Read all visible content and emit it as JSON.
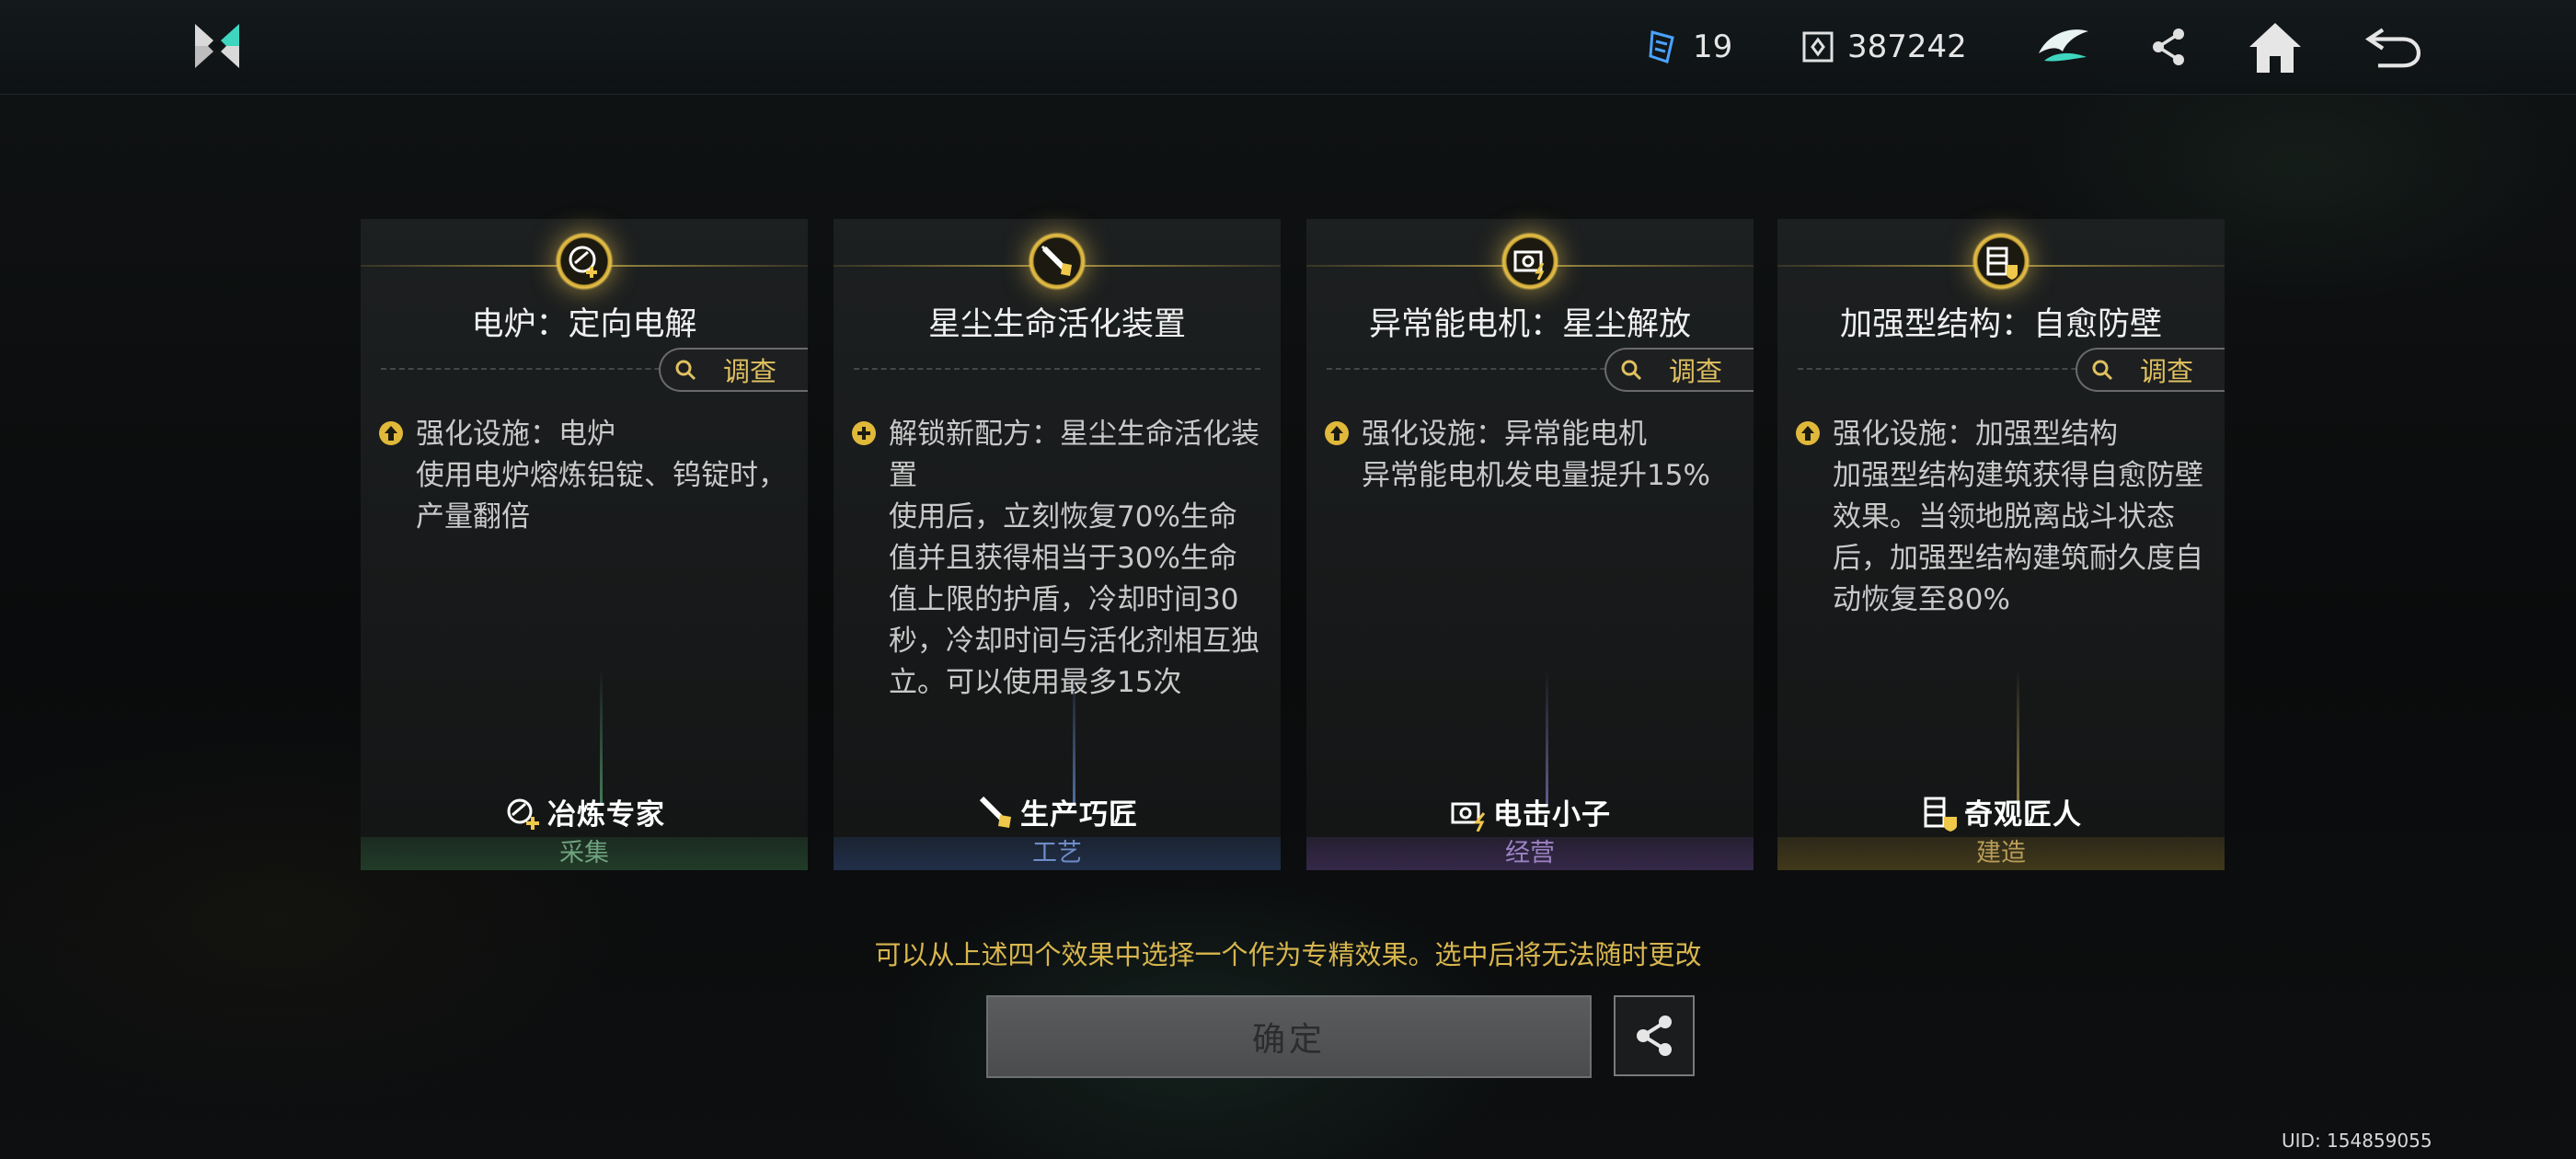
{
  "topbar": {
    "crystal_count": "19",
    "coin_count": "387242"
  },
  "cards": [
    {
      "title": "电炉：定向电解",
      "inspect": "调查",
      "effect_head": "强化设施：电炉",
      "effect_body": "使用电炉熔炼铝锭、钨锭时，产量翻倍",
      "role": "冶炼专家",
      "category": "采集"
    },
    {
      "title": "星尘生命活化装置",
      "inspect": "",
      "effect_head": "解锁新配方：星尘生命活化装置",
      "effect_body": "使用后，立刻恢复70%生命值并且获得相当于30%生命值上限的护盾，冷却时间30秒，冷却时间与活化剂相互独立。可以使用最多15次",
      "role": "生产巧匠",
      "category": "工艺"
    },
    {
      "title": "异常能电机：星尘解放",
      "inspect": "调查",
      "effect_head": "强化设施：异常能电机",
      "effect_body": "异常能电机发电量提升15%",
      "role": "电击小子",
      "category": "经营"
    },
    {
      "title": "加强型结构：自愈防壁",
      "inspect": "调查",
      "effect_head": "强化设施：加强型结构",
      "effect_body": "加强型结构建筑获得自愈防壁效果。当领地脱离战斗状态后，加强型结构建筑耐久度自动恢复至80%",
      "role": "奇观匠人",
      "category": "建造"
    }
  ],
  "hint": "可以从上述四个效果中选择一个作为专精效果。选中后将无法随时更改",
  "confirm_label": "确定",
  "uid": "UID: 154859055"
}
